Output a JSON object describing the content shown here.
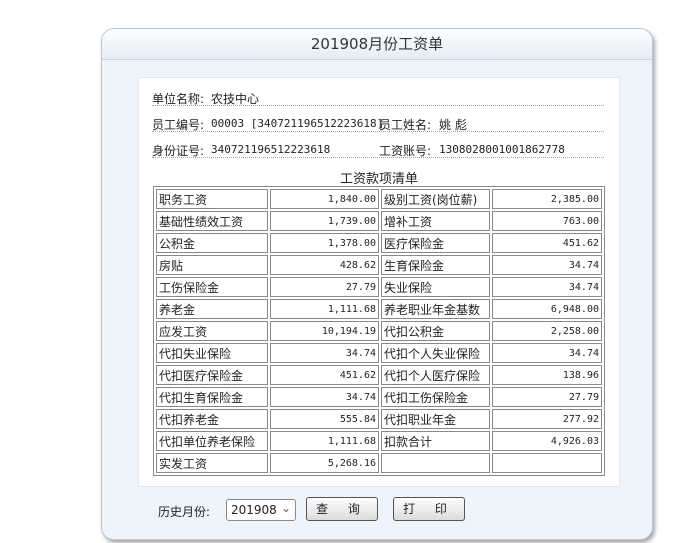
{
  "title": "201908月份工资单",
  "employee": {
    "unit_label": "单位名称:",
    "unit_value": "农技中心",
    "id_label": "员工编号:",
    "id_value": "00003 [340721196512223618]",
    "name_label": "员工姓名:",
    "name_value": "姚 彪",
    "idcard_label": "身份证号:",
    "idcard_value": "340721196512223618",
    "account_label": "工资账号:",
    "account_value": "1308028001001862778"
  },
  "section_title": "工资款项清单",
  "rows": [
    {
      "l_name": "职务工资",
      "l_val": "1,840.00",
      "r_name": "级别工资(岗位薪)",
      "r_val": "2,385.00"
    },
    {
      "l_name": "基础性绩效工资",
      "l_val": "1,739.00",
      "r_name": "增补工资",
      "r_val": "763.00"
    },
    {
      "l_name": "公积金",
      "l_val": "1,378.00",
      "r_name": "医疗保险金",
      "r_val": "451.62"
    },
    {
      "l_name": "房贴",
      "l_val": "428.62",
      "r_name": "生育保险金",
      "r_val": "34.74"
    },
    {
      "l_name": "工伤保险金",
      "l_val": "27.79",
      "r_name": "失业保险",
      "r_val": "34.74"
    },
    {
      "l_name": "养老金",
      "l_val": "1,111.68",
      "r_name": "养老职业年金基数",
      "r_val": "6,948.00"
    },
    {
      "l_name": "应发工资",
      "l_val": "10,194.19",
      "r_name": "代扣公积金",
      "r_val": "2,258.00"
    },
    {
      "l_name": "代扣失业保险",
      "l_val": "34.74",
      "r_name": "代扣个人失业保险",
      "r_val": "34.74"
    },
    {
      "l_name": "代扣医疗保险金",
      "l_val": "451.62",
      "r_name": "代扣个人医疗保险",
      "r_val": "138.96"
    },
    {
      "l_name": "代扣生育保险金",
      "l_val": "34.74",
      "r_name": "代扣工伤保险金",
      "r_val": "27.79"
    },
    {
      "l_name": "代扣养老金",
      "l_val": "555.84",
      "r_name": "代扣职业年金",
      "r_val": "277.92"
    },
    {
      "l_name": "代扣单位养老保险",
      "l_val": "1,111.68",
      "r_name": "扣款合计",
      "r_val": "4,926.03"
    },
    {
      "l_name": "实发工资",
      "l_val": "5,268.16",
      "r_name": "",
      "r_val": ""
    }
  ],
  "footer": {
    "history_label": "历史月份:",
    "month_value": "201908",
    "query_button": "查 询",
    "print_button": "打 印"
  }
}
